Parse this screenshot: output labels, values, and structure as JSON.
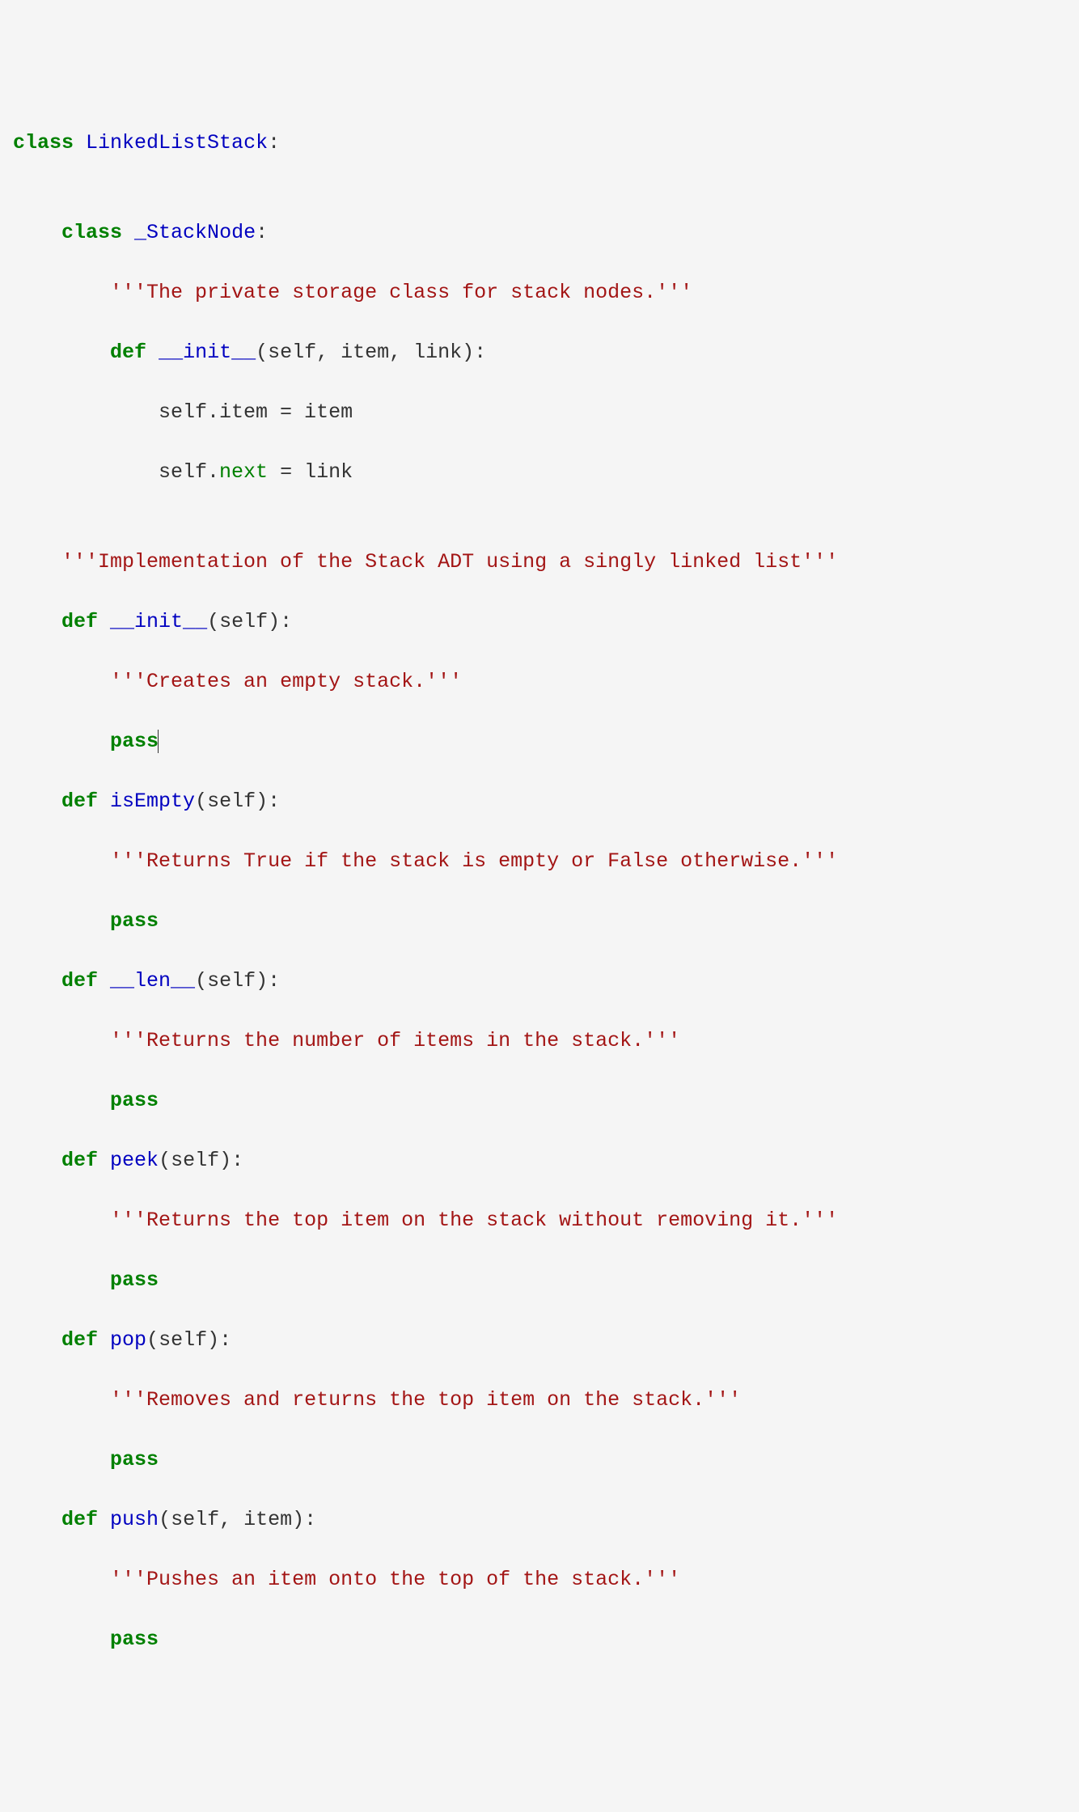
{
  "code": {
    "l01": {
      "kw1": "class",
      "name": "LinkedListStack",
      "tail": ":"
    },
    "l02_blank": "",
    "l03": {
      "indent": "    ",
      "kw": "class",
      "name": "_StackNode",
      "tail": ":"
    },
    "l04": {
      "indent": "        ",
      "doc": "'''The private storage class for stack nodes.'''"
    },
    "l05": {
      "indent": "        ",
      "kw": "def",
      "name": "__init__",
      "params": "(self, item, link):"
    },
    "l06": {
      "indent": "            ",
      "text": "self.item = item"
    },
    "l07": {
      "indent": "            ",
      "pre": "self.",
      "builtin": "next",
      "post": " = link"
    },
    "l08_blank": "",
    "l09": {
      "indent": "    ",
      "doc": "'''Implementation of the Stack ADT using a singly linked list'''"
    },
    "l10": {
      "indent": "    ",
      "kw": "def",
      "name": "__init__",
      "params": "(self):"
    },
    "l11": {
      "indent": "        ",
      "doc": "'''Creates an empty stack.'''"
    },
    "l12": {
      "indent": "        ",
      "kw": "pass"
    },
    "l13": {
      "indent": "    ",
      "kw": "def",
      "name": "isEmpty",
      "params": "(self):"
    },
    "l14": {
      "indent": "        ",
      "doc": "'''Returns True if the stack is empty or False otherwise.'''"
    },
    "l15": {
      "indent": "        ",
      "kw": "pass"
    },
    "l16": {
      "indent": "    ",
      "kw": "def",
      "name": "__len__",
      "params": "(self):"
    },
    "l17": {
      "indent": "        ",
      "doc": "'''Returns the number of items in the stack.'''"
    },
    "l18": {
      "indent": "        ",
      "kw": "pass"
    },
    "l19": {
      "indent": "    ",
      "kw": "def",
      "name": "peek",
      "params": "(self):"
    },
    "l20": {
      "indent": "        ",
      "doc": "'''Returns the top item on the stack without removing it.'''"
    },
    "l21": {
      "indent": "        ",
      "kw": "pass"
    },
    "l22": {
      "indent": "    ",
      "kw": "def",
      "name": "pop",
      "params": "(self):"
    },
    "l23": {
      "indent": "        ",
      "doc": "'''Removes and returns the top item on the stack.'''"
    },
    "l24": {
      "indent": "        ",
      "kw": "pass"
    },
    "l25": {
      "indent": "    ",
      "kw": "def",
      "name": "push",
      "params": "(self, item):"
    },
    "l26": {
      "indent": "        ",
      "doc": "'''Pushes an item onto the top of the stack.'''"
    },
    "l27": {
      "indent": "        ",
      "kw": "pass"
    }
  }
}
